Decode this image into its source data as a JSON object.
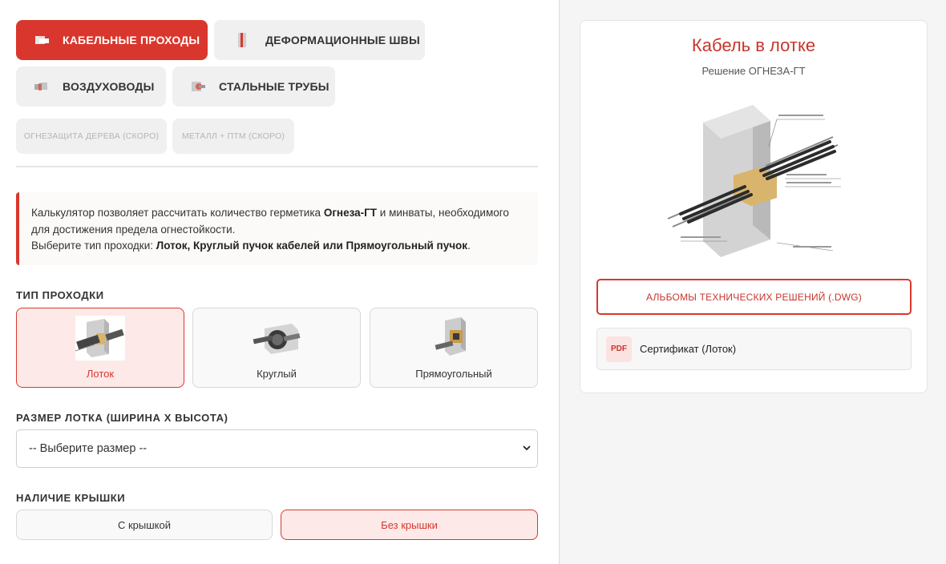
{
  "tabs": {
    "cable": "КАБЕЛЬНЫЕ ПРОХОДЫ",
    "deform": "ДЕФОРМАЦИОННЫЕ ШВЫ",
    "air": "ВОЗДУХОВОДЫ",
    "steel": "СТАЛЬНЫЕ ТРУБЫ",
    "wood": "ОГНЕЗАЩИТА ДЕРЕВА (СКОРО)",
    "metal": "МЕТАЛЛ + ПТМ (СКОРО)"
  },
  "info": {
    "line1_a": "Калькулятор позволяет рассчитать количество герметика ",
    "line1_b": "Огнеза-ГТ",
    "line1_c": " и минваты, необходимого",
    "line2": "для достижения предела огнестойкости.",
    "line3_a": "Выберите тип проходки: ",
    "line3_b": "Лоток, Круглый пучок кабелей или Прямоугольный пучок",
    "line3_c": "."
  },
  "type_section": {
    "label": "ТИП ПРОХОДКИ",
    "options": [
      "Лоток",
      "Круглый",
      "Прямоугольный"
    ],
    "selected": "Лоток"
  },
  "size_section": {
    "label": "РАЗМЕР ЛОТКА (ШИРИНА Х ВЫСОТА)",
    "select_value": "-- Выберите размер --"
  },
  "cover_section": {
    "label": "НАЛИЧИЕ КРЫШКИ",
    "with_cover": "С крышкой",
    "without_cover": "Без крышки",
    "selected": "Без крышки"
  },
  "detail": {
    "title": "Кабель в лотке",
    "subtitle": "Решение ОГНЕЗА-ГТ",
    "album_button": "АЛЬБОМЫ ТЕХНИЧЕСКИХ РЕШЕНИЙ (.DWG)",
    "pdf_badge": "PDF",
    "certificate": "Сертификат (Лоток)"
  },
  "colors": {
    "accent": "#d9372d",
    "accent_light": "#fde9e8"
  }
}
